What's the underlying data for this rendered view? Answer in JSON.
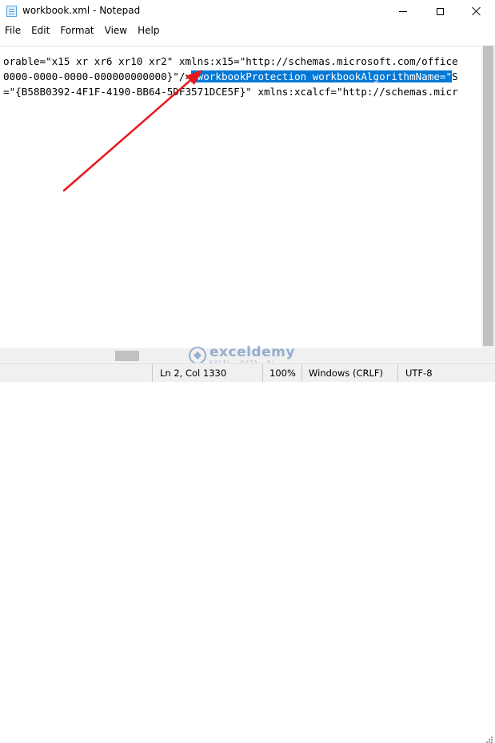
{
  "window": {
    "title": "workbook.xml - Notepad",
    "app_icon": "notepad-icon",
    "controls": [
      "minimize-icon",
      "maximize-icon",
      "close-icon"
    ]
  },
  "menu": [
    "File",
    "Edit",
    "Format",
    "View",
    "Help"
  ],
  "editor": {
    "lines": [
      {
        "before": "orable=\"x15 xr xr6 xr10 xr2\" xmlns:x15=\"http://schemas.microsoft.com/office",
        "selected": "",
        "after": ""
      },
      {
        "before": "0000-0000-0000-000000000000}\"/>",
        "selected": "<workbookProtection workbookAlgorithmName=\"",
        "after": "S"
      },
      {
        "before": "=\"{B58B0392-4F1F-4190-BB64-5DF3571DCE5F}\" xmlns:xcalcf=\"http://schemas.micr",
        "selected": "",
        "after": ""
      }
    ],
    "selection_color": "#0078d7"
  },
  "annotation": {
    "arrow_color": "#e8191c",
    "points_to": "<workbookProtection workbookAlgorithmName=\""
  },
  "statusbar": {
    "position": "Ln 2, Col 1330",
    "zoom": "100%",
    "line_ending": "Windows (CRLF)",
    "encoding": "UTF-8"
  },
  "watermark": {
    "name": "exceldemy",
    "tagline": "EXCEL · DATA · BI",
    "icon": "exceldemy-logo-icon"
  }
}
